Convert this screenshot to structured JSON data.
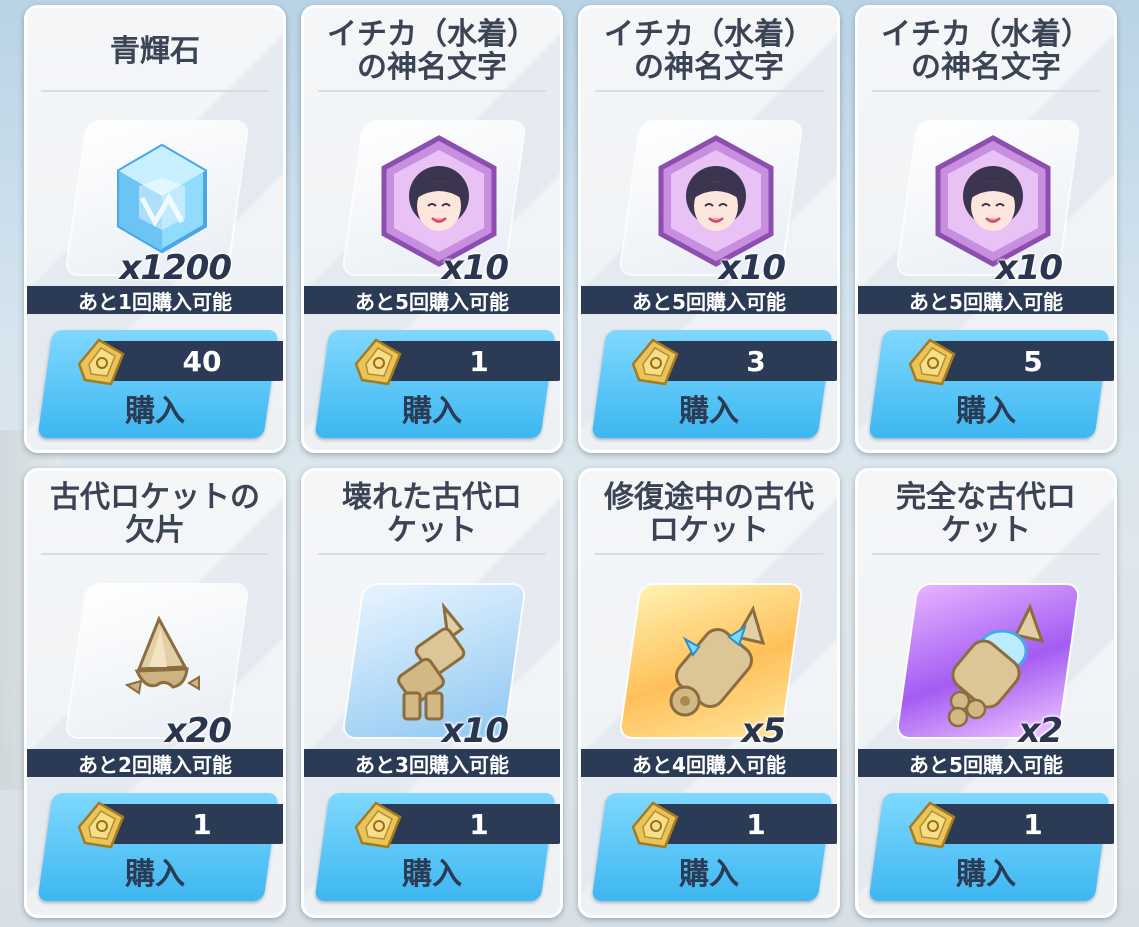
{
  "shop": {
    "buy_label": "購入",
    "items": [
      {
        "name": "青輝石",
        "qty": "x1200",
        "limit": "あと1回購入可能",
        "price": "40",
        "icon": "blue-crystal-icon"
      },
      {
        "name": "イチカ（水着）\nの神名文字",
        "qty": "x10",
        "limit": "あと5回購入可能",
        "price": "1",
        "icon": "eleph-portrait-icon"
      },
      {
        "name": "イチカ（水着）\nの神名文字",
        "qty": "x10",
        "limit": "あと5回購入可能",
        "price": "3",
        "icon": "eleph-portrait-icon"
      },
      {
        "name": "イチカ（水着）\nの神名文字",
        "qty": "x10",
        "limit": "あと5回購入可能",
        "price": "5",
        "icon": "eleph-portrait-icon"
      },
      {
        "name": "古代ロケットの\n欠片",
        "qty": "x20",
        "limit": "あと2回購入可能",
        "price": "1",
        "icon": "rocket-fragment-icon"
      },
      {
        "name": "壊れた古代ロ\nケット",
        "qty": "x10",
        "limit": "あと3回購入可能",
        "price": "1",
        "icon": "broken-rocket-icon"
      },
      {
        "name": "修復途中の古代\nロケット",
        "qty": "x5",
        "limit": "あと4回購入可能",
        "price": "1",
        "icon": "repairing-rocket-icon"
      },
      {
        "name": "完全な古代ロ\nケット",
        "qty": "x2",
        "limit": "あと5回購入可能",
        "price": "1",
        "icon": "complete-rocket-icon"
      }
    ],
    "currency_icon": "gold-ticket-icon"
  }
}
